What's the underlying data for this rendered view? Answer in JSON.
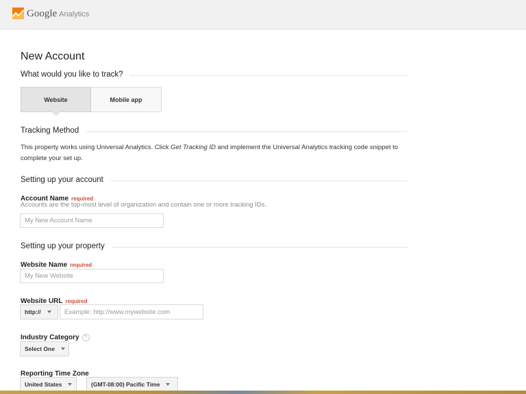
{
  "header": {
    "brand": "Google",
    "brand_sub": "Analytics"
  },
  "page": {
    "title": "New Account"
  },
  "track": {
    "question": "What would you like to track?",
    "options": [
      "Website",
      "Mobile app"
    ],
    "selected": "Website"
  },
  "tracking_method": {
    "heading": "Tracking Method",
    "text_before": "This property works using Universal Analytics. Click ",
    "text_em": "Get Tracking ID",
    "text_after": " and implement the Universal Analytics tracking code snippet to complete your set up."
  },
  "account": {
    "heading": "Setting up your account",
    "name_label": "Account Name",
    "required_label": "required",
    "help": "Accounts are the top-most level of organization and contain one or more tracking IDs.",
    "name_placeholder": "My New Account Name"
  },
  "property": {
    "heading": "Setting up your property",
    "website_name_label": "Website Name",
    "website_name_placeholder": "My New Website",
    "url_label": "Website URL",
    "protocol": "http://",
    "url_placeholder": "Example: http://www.mywebsite.com",
    "industry_label": "Industry Category",
    "industry_help": "?",
    "industry_value": "Select One",
    "timezone_label": "Reporting Time Zone",
    "country_value": "United States",
    "timezone_value": "(GMT-08:00) Pacific Time"
  },
  "colors": {
    "logo_orange": "#f57c00",
    "logo_light": "#ffb74d",
    "required_red": "#d14836"
  }
}
